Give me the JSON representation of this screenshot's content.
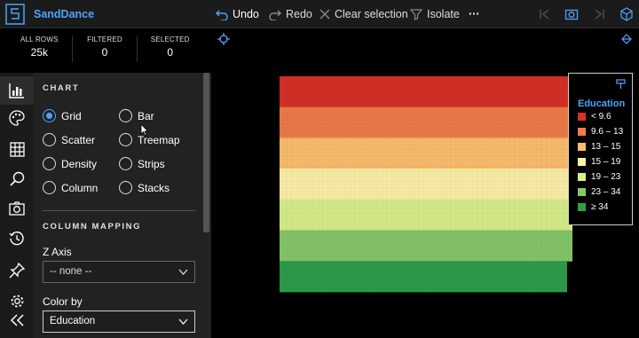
{
  "app": {
    "name": "SandDance"
  },
  "toolbar": {
    "undo": "Undo",
    "redo": "Redo",
    "clear": "Clear selection",
    "isolate": "Isolate",
    "more": "···"
  },
  "stats": [
    {
      "label": "ALL ROWS",
      "value": "25k"
    },
    {
      "label": "FILTERED",
      "value": "0"
    },
    {
      "label": "SELECTED",
      "value": "0"
    }
  ],
  "sidebar": {
    "icons": [
      "chart-icon",
      "palette-icon",
      "table-icon",
      "search-icon",
      "camera-icon",
      "history-icon",
      "pin-icon",
      "settings-icon",
      "collapse-icon"
    ]
  },
  "chart_panel": {
    "title": "CHART",
    "types": [
      "Grid",
      "Bar",
      "Scatter",
      "Treemap",
      "Density",
      "Strips",
      "Column",
      "Stacks"
    ],
    "selected": "Grid",
    "mapping_title": "COLUMN MAPPING",
    "z_axis_label": "Z Axis",
    "z_axis_value": "-- none --",
    "color_label": "Color by",
    "color_value": "Education"
  },
  "legend": {
    "title": "Education",
    "items": [
      {
        "label": "< 9.6",
        "color": "#d73027"
      },
      {
        "label": "9.6 – 13",
        "color": "#f07c4a"
      },
      {
        "label": "13 – 15",
        "color": "#fdbf6f"
      },
      {
        "label": "15 – 19",
        "color": "#fef1a8"
      },
      {
        "label": "19 – 23",
        "color": "#d9ef8b"
      },
      {
        "label": "23 – 34",
        "color": "#86c86a"
      },
      {
        "label": "≥ 34",
        "color": "#2e9e4b"
      }
    ]
  },
  "chart_data": {
    "type": "heatmap",
    "categories": [
      "< 9.6",
      "9.6 – 13",
      "13 – 15",
      "15 – 19",
      "19 – 23",
      "23 – 34",
      "≥ 34"
    ],
    "colors": [
      "#d73027",
      "#f07c4a",
      "#fdbf6f",
      "#fef1a8",
      "#d9ef8b",
      "#86c86a",
      "#2e9e4b"
    ]
  }
}
